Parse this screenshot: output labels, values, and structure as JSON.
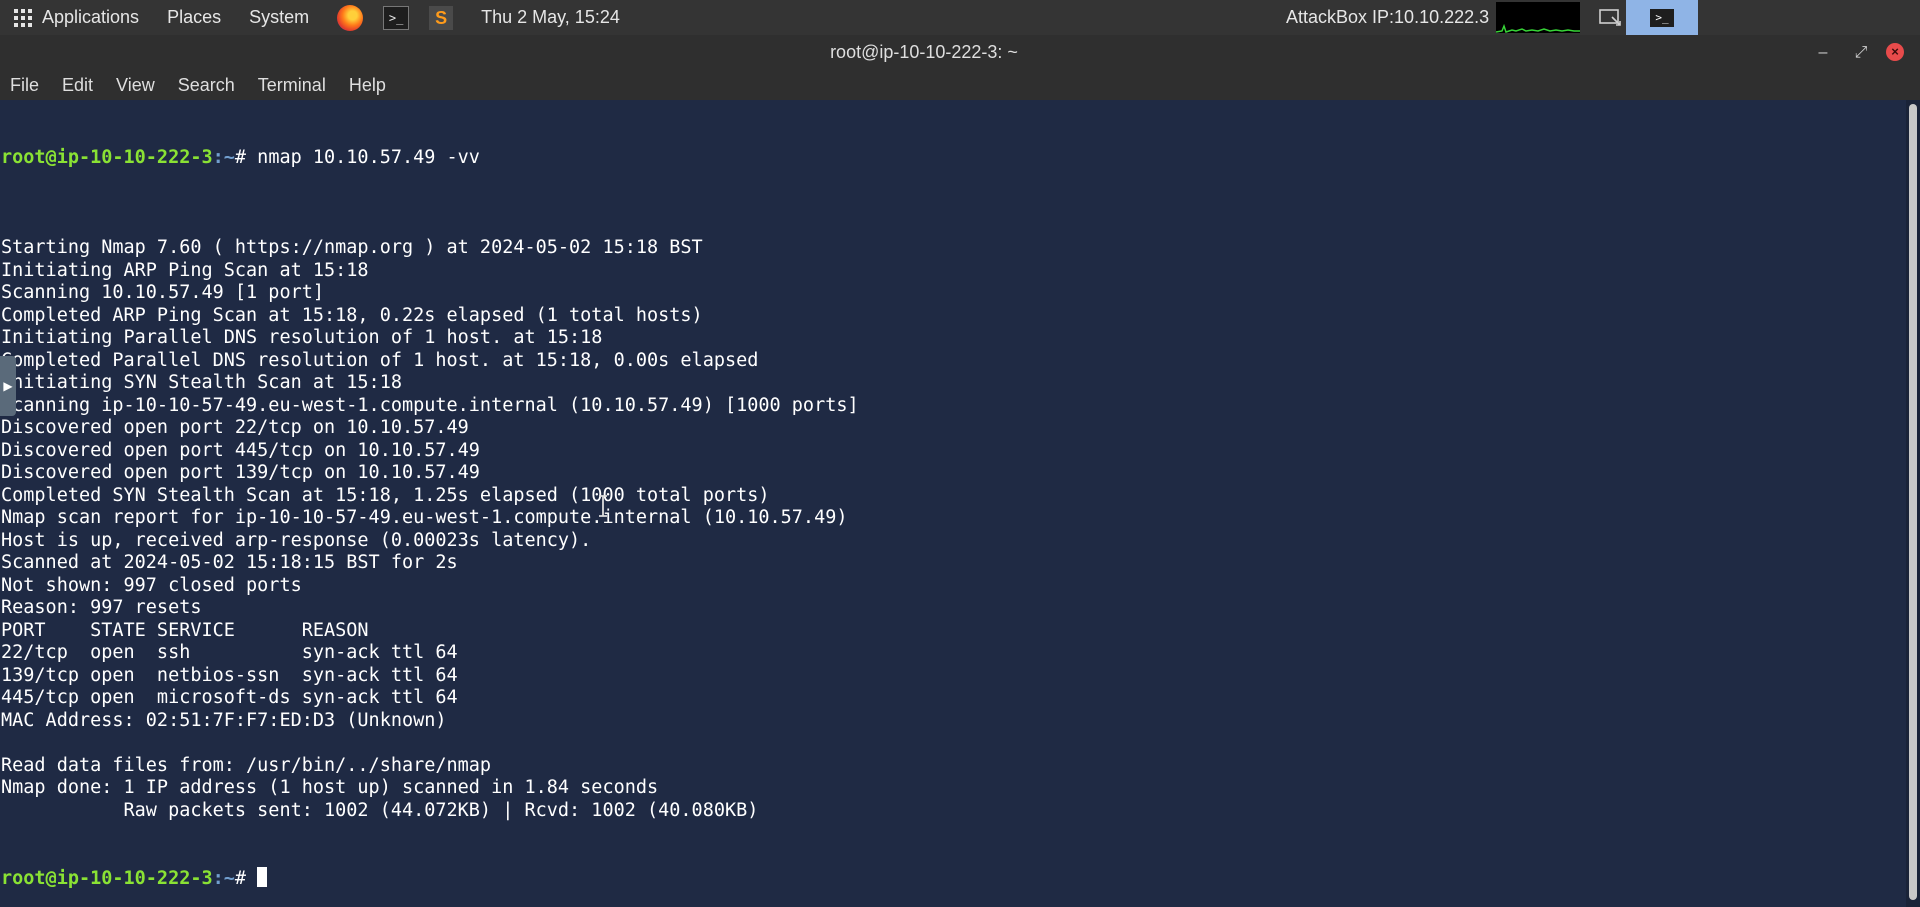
{
  "panel": {
    "applications": "Applications",
    "places": "Places",
    "system": "System",
    "clock": "Thu 2 May, 15:24",
    "attackbox_ip": "AttackBox IP:10.10.222.3"
  },
  "window": {
    "title": "root@ip-10-10-222-3: ~"
  },
  "menu": {
    "file": "File",
    "edit": "Edit",
    "view": "View",
    "search": "Search",
    "terminal": "Terminal",
    "help": "Help"
  },
  "terminal": {
    "prompt_user": "root@ip-10-10-222-3",
    "prompt_path": ":~",
    "prompt_symbol": "#",
    "command": " nmap 10.10.57.49 -vv",
    "output": [
      "",
      "Starting Nmap 7.60 ( https://nmap.org ) at 2024-05-02 15:18 BST",
      "Initiating ARP Ping Scan at 15:18",
      "Scanning 10.10.57.49 [1 port]",
      "Completed ARP Ping Scan at 15:18, 0.22s elapsed (1 total hosts)",
      "Initiating Parallel DNS resolution of 1 host. at 15:18",
      "Completed Parallel DNS resolution of 1 host. at 15:18, 0.00s elapsed",
      "Initiating SYN Stealth Scan at 15:18",
      "Scanning ip-10-10-57-49.eu-west-1.compute.internal (10.10.57.49) [1000 ports]",
      "Discovered open port 22/tcp on 10.10.57.49",
      "Discovered open port 445/tcp on 10.10.57.49",
      "Discovered open port 139/tcp on 10.10.57.49",
      "Completed SYN Stealth Scan at 15:18, 1.25s elapsed (1000 total ports)",
      "Nmap scan report for ip-10-10-57-49.eu-west-1.compute.internal (10.10.57.49)",
      "Host is up, received arp-response (0.00023s latency).",
      "Scanned at 2024-05-02 15:18:15 BST for 2s",
      "Not shown: 997 closed ports",
      "Reason: 997 resets",
      "PORT    STATE SERVICE      REASON",
      "22/tcp  open  ssh          syn-ack ttl 64",
      "139/tcp open  netbios-ssn  syn-ack ttl 64",
      "445/tcp open  microsoft-ds syn-ack ttl 64",
      "MAC Address: 02:51:7F:F7:ED:D3 (Unknown)",
      "",
      "Read data files from: /usr/bin/../share/nmap",
      "Nmap done: 1 IP address (1 host up) scanned in 1.84 seconds",
      "           Raw packets sent: 1002 (44.072KB) | Rcvd: 1002 (40.080KB)"
    ]
  },
  "icons": {
    "apps": "apps-grid-icon",
    "browser": "firefox-icon",
    "terminal": "terminal-icon",
    "editor": "sublime-text-icon"
  },
  "colors": {
    "terminal_bg": "#1f2a44",
    "prompt_user": "#8ae234",
    "prompt_path": "#729fcf",
    "panel_bg": "#343434",
    "close_button": "#e84b4b"
  }
}
